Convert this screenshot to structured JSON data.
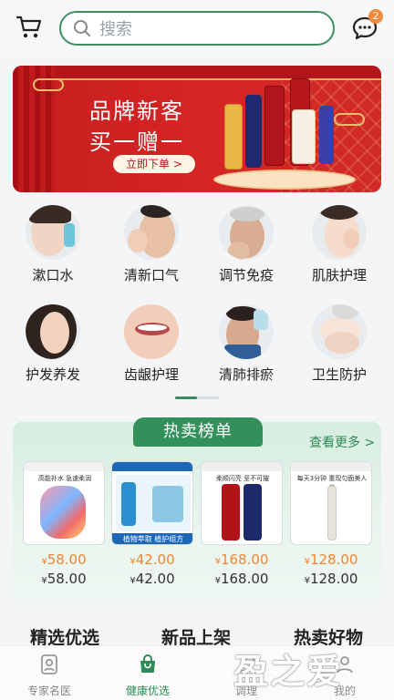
{
  "header": {
    "search_placeholder": "搜索",
    "message_count": "2"
  },
  "banner": {
    "line1": "品牌新客",
    "line2": "买一赠一",
    "cta": "立即下单 >"
  },
  "categories": [
    {
      "label": "漱口水"
    },
    {
      "label": "清新口气"
    },
    {
      "label": "调节免疫"
    },
    {
      "label": "肌肤护理"
    },
    {
      "label": "护发养发"
    },
    {
      "label": "齿龈护理"
    },
    {
      "label": "清肺排瘀"
    },
    {
      "label": "卫生防护"
    }
  ],
  "hot": {
    "title": "热卖榜单",
    "more": "查看更多 >",
    "products": [
      {
        "caption": "高能补水 急速柔润",
        "price": "58.00",
        "orig": "58.00"
      },
      {
        "caption": "植物萃取 植护组方",
        "price": "42.00",
        "orig": "42.00"
      },
      {
        "caption": "柔顺闪亮 坚不可摧",
        "price": "168.00",
        "orig": "168.00"
      },
      {
        "caption": "每天3分钟 重现匀面美人尖",
        "price": "128.00",
        "orig": "128.00"
      }
    ],
    "currency": "¥"
  },
  "sections": {
    "s1": "精选优选",
    "s2": "新品上架",
    "s3": "热卖好物"
  },
  "nav": {
    "items": [
      {
        "label": "专家名医"
      },
      {
        "label": "健康优选"
      },
      {
        "label": "调理"
      },
      {
        "label": "我的"
      }
    ]
  },
  "watermark": "盈之爱",
  "colors": {
    "accent": "#34905a",
    "price": "#f0852f",
    "banner": "#d62525"
  }
}
